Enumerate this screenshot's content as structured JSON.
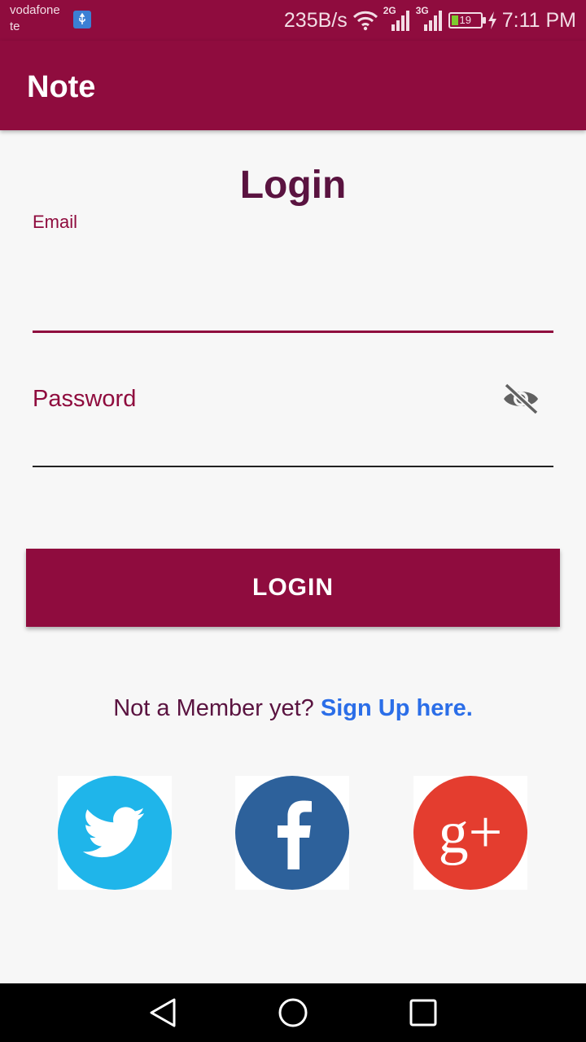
{
  "status_bar": {
    "carrier_line1": "vodafone",
    "carrier_line2": "te",
    "net_speed": "235B/s",
    "net_2g": "2G",
    "net_3g": "3G",
    "battery_level": "19",
    "time": "7:11 PM"
  },
  "app_bar": {
    "title": "Note"
  },
  "form": {
    "heading": "Login",
    "email_label": "Email",
    "email_value": "",
    "password_placeholder": "Password",
    "login_button": "LOGIN"
  },
  "signup": {
    "prompt": "Not a Member yet?",
    "link": "Sign Up here."
  },
  "social": [
    {
      "name": "twitter",
      "color": "#1fb5ea",
      "icon": "twitter-bird-icon"
    },
    {
      "name": "facebook",
      "color": "#2d619b",
      "icon": "facebook-f-icon",
      "glyph": "f"
    },
    {
      "name": "google-plus",
      "color": "#e43d2f",
      "icon": "google-plus-icon",
      "glyph": "g+"
    }
  ],
  "colors": {
    "primary": "#8f0c3e",
    "heading": "#5a1340",
    "link": "#2b6ee8",
    "background": "#f7f7f7"
  }
}
